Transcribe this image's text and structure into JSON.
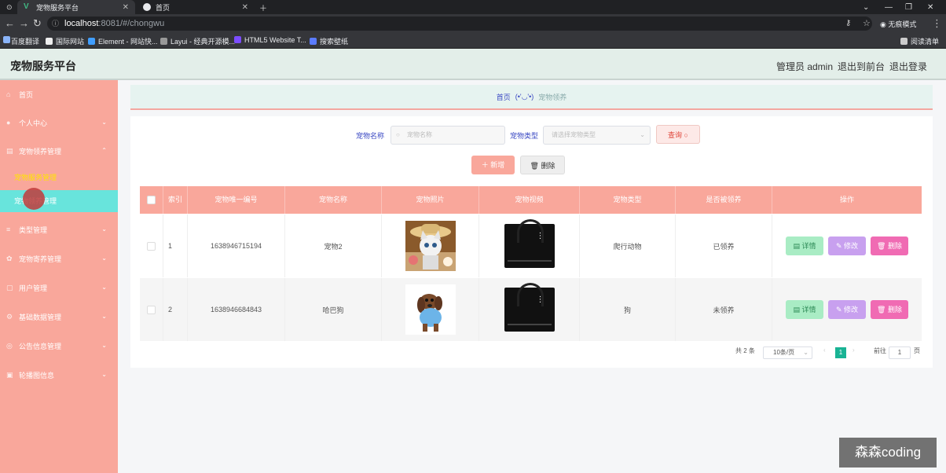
{
  "browser": {
    "tabs": [
      {
        "label": "宠物服务平台"
      },
      {
        "label": "首页"
      }
    ],
    "url_host": "localhost",
    "url_path": ":8081/#/chongwu",
    "profile_label": "无痕模式",
    "bookmarks": [
      "百度翻译",
      "国际网站",
      "Element - 网站快...",
      "Layui - 经典开源模...",
      "HTML5 Website T...",
      "搜索壁纸"
    ],
    "reading_list": "阅读清单"
  },
  "header": {
    "title": "宠物服务平台",
    "admin": "管理员 admin",
    "to_front": "退出到前台",
    "logout": "退出登录"
  },
  "sidebar": {
    "items": [
      {
        "label": "首页"
      },
      {
        "label": "个人中心"
      },
      {
        "label": "宠物领养管理"
      },
      {
        "label": "宠物服务管理"
      },
      {
        "label": "宠物领养管理"
      },
      {
        "label": "类型管理"
      },
      {
        "label": "宠物寄养管理"
      },
      {
        "label": "用户管理"
      },
      {
        "label": "基础数据管理"
      },
      {
        "label": "公告信息管理"
      },
      {
        "label": "轮播图信息"
      }
    ]
  },
  "breadcrumb": {
    "home": "首页",
    "sep": "(•'◡'•)",
    "current": "宠物领养"
  },
  "search": {
    "name_label": "宠物名称",
    "name_placeholder": "宠物名称",
    "type_label": "宠物类型",
    "type_placeholder": "请选择宠物类型",
    "query_label": "查询"
  },
  "actions": {
    "add": "新增",
    "delete": "删除"
  },
  "table": {
    "headers": [
      "索引",
      "宠物唯一编号",
      "宠物名称",
      "宠物照片",
      "宠物视频",
      "宠物类型",
      "是否被领养",
      "操作"
    ],
    "rows": [
      {
        "index": "1",
        "code": "1638946715194",
        "name": "宠物2",
        "type": "爬行动物",
        "adopted": "已领养"
      },
      {
        "index": "2",
        "code": "1638946684843",
        "name": "哈巴狗",
        "type": "狗",
        "adopted": "未领养"
      }
    ],
    "op_detail": "详情",
    "op_edit": "修改",
    "op_delete": "删除"
  },
  "pagination": {
    "total": "共 2 条",
    "page_size": "10条/页",
    "current_page": "1",
    "goto_label": "前往",
    "goto_value": "1",
    "page_unit": "页"
  },
  "watermark": "森森coding"
}
